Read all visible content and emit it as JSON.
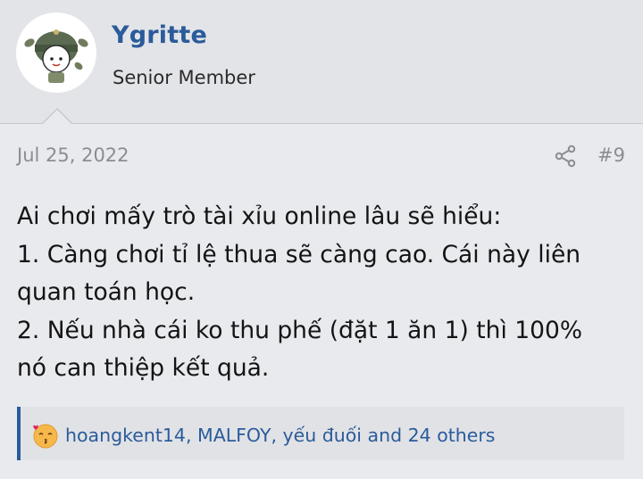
{
  "user": {
    "name": "Ygritte",
    "title": "Senior Member"
  },
  "post": {
    "date": "Jul 25, 2022",
    "number": "#9",
    "lines": [
      "Ai chơi mấy trò tài xỉu online lâu sẽ hiểu:",
      "1. Càng chơi tỉ lệ thua sẽ càng cao. Cái này liên",
      "quan toán học.",
      "2. Nếu nhà cái ko thu phế (đặt 1 ăn 1) thì 100%",
      "nó can thiệp kết quả."
    ]
  },
  "reactions": {
    "text": "hoangkent14, MALFOY, yếu đuối and 24 others",
    "emoji": "kiss-emoji-icon"
  },
  "colors": {
    "accent": "#2a5b9a",
    "muted": "#8a8d93",
    "background": "#e9eaee"
  }
}
